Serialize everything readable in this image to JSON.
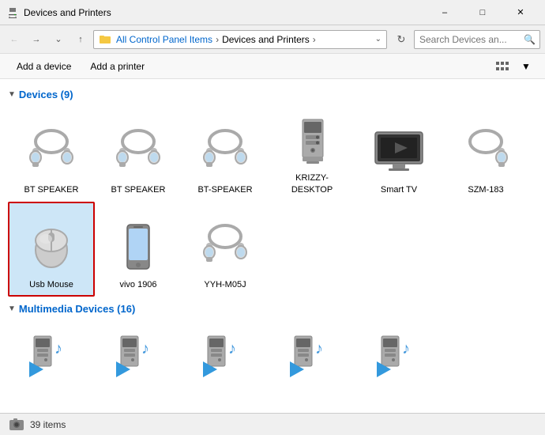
{
  "window": {
    "title": "Devices and Printers",
    "icon": "printer-icon"
  },
  "nav": {
    "back_label": "←",
    "forward_label": "→",
    "up_label": "↑",
    "breadcrumb": [
      {
        "label": "All Control Panel Items",
        "id": "control-panel"
      },
      {
        "label": "Devices and Printers",
        "id": "devices-printers"
      }
    ],
    "search_placeholder": "Search Devices an...",
    "refresh_label": "⟳"
  },
  "toolbar": {
    "add_device_label": "Add a device",
    "add_printer_label": "Add a printer"
  },
  "sections": [
    {
      "id": "devices",
      "label": "Devices (9)",
      "collapsed": false,
      "items": [
        {
          "id": "bt-speaker-1",
          "label": "BT SPEAKER",
          "icon": "bt-speaker-icon",
          "selected": false
        },
        {
          "id": "bt-speaker-2",
          "label": "BT SPEAKER",
          "icon": "bt-speaker-icon",
          "selected": false
        },
        {
          "id": "bt-speaker-3",
          "label": "BT-SPEAKER",
          "icon": "bt-speaker-icon",
          "selected": false
        },
        {
          "id": "desktop",
          "label": "KRIZZY-DESKTOP",
          "icon": "desktop-icon",
          "selected": false
        },
        {
          "id": "smart-tv",
          "label": "Smart TV",
          "icon": "tv-icon",
          "selected": false
        },
        {
          "id": "szm",
          "label": "SZM-183",
          "icon": "bt-speaker-icon-r",
          "selected": false
        },
        {
          "id": "usb-mouse",
          "label": "Usb Mouse",
          "icon": "mouse-icon",
          "selected": true
        },
        {
          "id": "vivo",
          "label": "vivo 1906",
          "icon": "phone-icon",
          "selected": false
        },
        {
          "id": "yyh",
          "label": "YYH-M05J",
          "icon": "bt-speaker-icon",
          "selected": false
        }
      ]
    },
    {
      "id": "multimedia",
      "label": "Multimedia Devices (16)",
      "collapsed": false,
      "items": [
        {
          "id": "mm1",
          "icon": "multimedia-icon"
        },
        {
          "id": "mm2",
          "icon": "multimedia-icon"
        },
        {
          "id": "mm3",
          "icon": "multimedia-icon"
        },
        {
          "id": "mm4",
          "icon": "multimedia-icon"
        },
        {
          "id": "mm5",
          "icon": "multimedia-icon"
        }
      ]
    }
  ],
  "status": {
    "count": "39 items",
    "camera_label": ""
  },
  "colors": {
    "accent_blue": "#0066cc",
    "selected_border": "#cc0000",
    "selected_bg": "#cde6f7",
    "section_header": "#0066cc"
  }
}
